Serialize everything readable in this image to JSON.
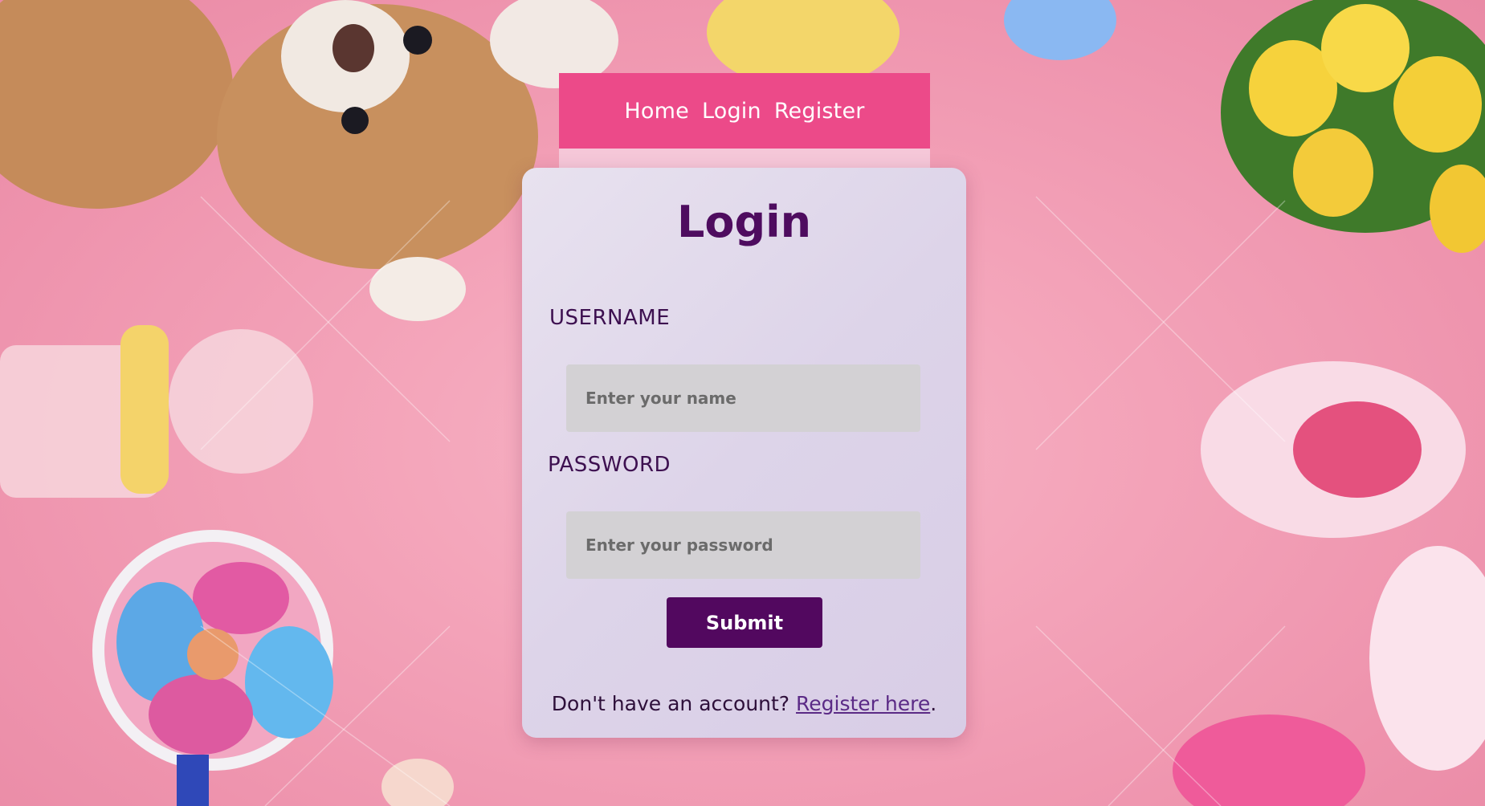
{
  "nav": {
    "items": [
      {
        "label": "Home"
      },
      {
        "label": "Login"
      },
      {
        "label": "Register"
      }
    ]
  },
  "login": {
    "title": "Login",
    "username_label": "USERNAME",
    "username_placeholder": "Enter your name",
    "password_label": "PASSWORD",
    "password_placeholder": "Enter your password",
    "submit_label": "Submit",
    "register_prompt": "Don't have an account? ",
    "register_link": "Register here",
    "register_suffix": "."
  },
  "colors": {
    "nav_bg": "#ec4a89",
    "title": "#4e0c5f",
    "button_bg": "#52085f",
    "link": "#5b2a86",
    "background": "#f3a2b8"
  }
}
